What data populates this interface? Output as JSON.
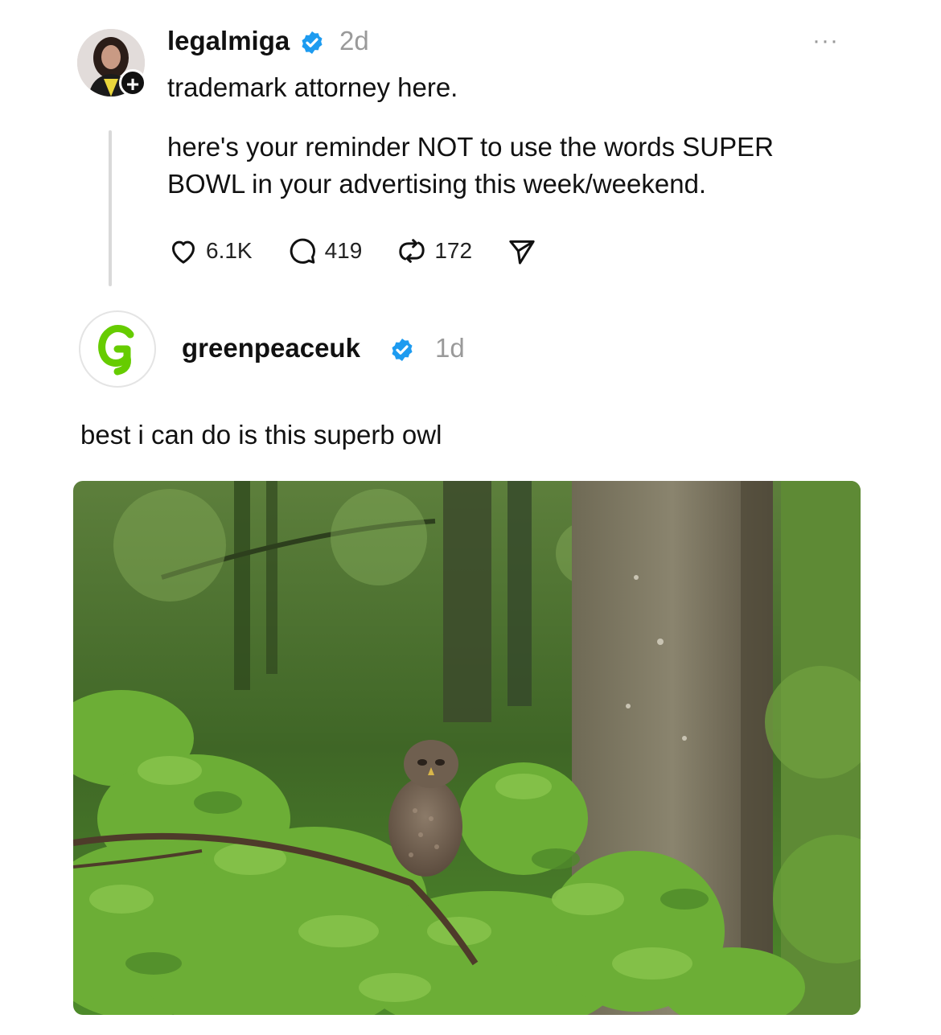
{
  "post1": {
    "username": "legalmiga",
    "time": "2d",
    "line1": "trademark attorney here.",
    "line2": "here's your reminder NOT to use the words SUPER",
    "line3": "BOWL in your advertising this week/weekend.",
    "likes": "6.1K",
    "replies": "419",
    "reposts": "172",
    "more_label": "···",
    "follow_label": "+"
  },
  "post2": {
    "username": "greenpeaceuk",
    "time": "1d",
    "text": "best i can do is this superb owl"
  },
  "colors": {
    "verified_blue": "#1d9bf0",
    "greenpeace_green": "#66cc00",
    "forest_green": "#4f8a2a"
  },
  "icons": [
    "verified-icon",
    "heart-icon",
    "comment-icon",
    "repost-icon",
    "send-icon",
    "greenpeace-logo"
  ]
}
